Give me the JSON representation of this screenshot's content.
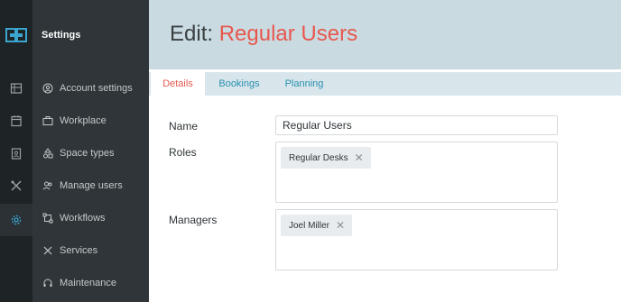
{
  "sidebar": {
    "title": "Settings",
    "items": [
      {
        "label": "Account settings",
        "icon": "account-icon"
      },
      {
        "label": "Workplace",
        "icon": "briefcase-icon"
      },
      {
        "label": "Space types",
        "icon": "shapes-icon"
      },
      {
        "label": "Manage users",
        "icon": "users-icon"
      },
      {
        "label": "Workflows",
        "icon": "workflow-icon"
      },
      {
        "label": "Services",
        "icon": "tools-icon"
      },
      {
        "label": "Maintenance",
        "icon": "headset-icon"
      }
    ]
  },
  "rail": {
    "icons": [
      "building-icon",
      "calendar-icon",
      "badge-icon",
      "tools-icon",
      "gear-icon"
    ],
    "active": "gear-icon"
  },
  "header": {
    "prefix": "Edit:",
    "name": "Regular Users"
  },
  "tabs": [
    {
      "label": "Details",
      "active": true
    },
    {
      "label": "Bookings",
      "active": false
    },
    {
      "label": "Planning",
      "active": false
    }
  ],
  "form": {
    "name_label": "Name",
    "name_value": "Regular Users",
    "roles_label": "Roles",
    "roles": [
      "Regular Desks"
    ],
    "managers_label": "Managers",
    "managers": [
      "Joel Miller"
    ]
  },
  "colors": {
    "accent": "#e8574e",
    "link": "#2a8fb0",
    "sidebar": "#2f3538",
    "header": "#c9dbe1"
  }
}
